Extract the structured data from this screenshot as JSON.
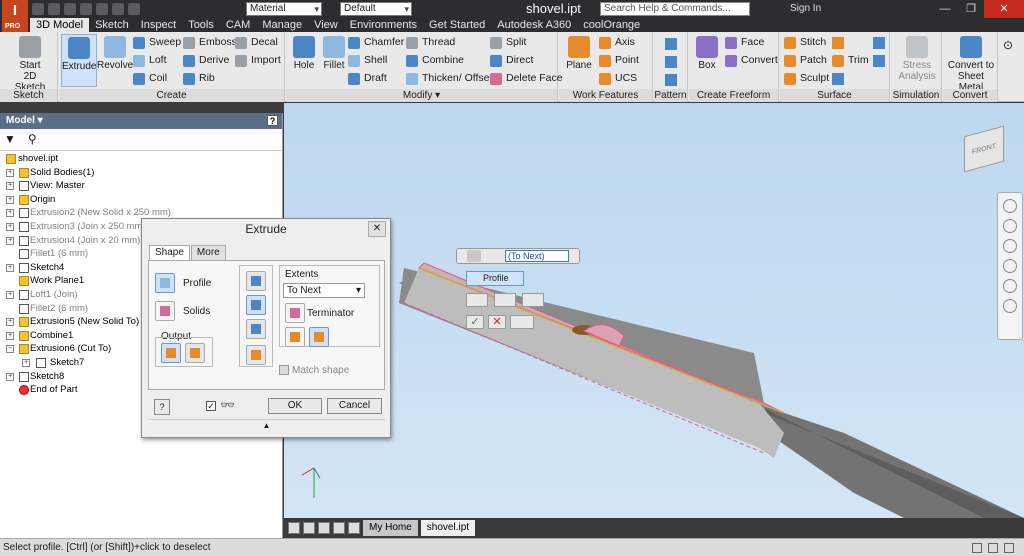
{
  "title": {
    "logo_letter": "I",
    "logo_sub": "PRO",
    "material": "Material",
    "appearance": "Default",
    "doc_name": "shovel.ipt",
    "search_placeholder": "Search Help & Commands...",
    "sign_in": "Sign In"
  },
  "tabs": [
    "3D Model",
    "Sketch",
    "Inspect",
    "Tools",
    "CAM",
    "Manage",
    "View",
    "Environments",
    "Get Started",
    "Autodesk A360",
    "coolOrange"
  ],
  "ribbon": {
    "sketch": {
      "start_line1": "Start",
      "start_line2": "2D Sketch",
      "title": "Sketch"
    },
    "create": {
      "extrude": "Extrude",
      "revolve": "Revolve",
      "sweep": "Sweep",
      "emboss": "Emboss",
      "decal": "Decal",
      "loft": "Loft",
      "derive": "Derive",
      "import": "Import",
      "coil": "Coil",
      "rib": "Rib",
      "title": "Create"
    },
    "modify": {
      "hole": "Hole",
      "fillet": "Fillet",
      "chamfer": "Chamfer",
      "thread": "Thread",
      "split": "Split",
      "shell": "Shell",
      "combine": "Combine",
      "direct": "Direct",
      "draft": "Draft",
      "thicken": "Thicken/ Offset",
      "delete_face": "Delete Face",
      "title": "Modify ▾"
    },
    "work": {
      "plane": "Plane",
      "axis": "Axis",
      "point": "Point",
      "ucs": "UCS",
      "title": "Work Features"
    },
    "pattern": {
      "title": "Pattern"
    },
    "freeform": {
      "box": "Box",
      "face": "Face",
      "convert": "Convert",
      "title": "Create Freeform"
    },
    "surface": {
      "stitch": "Stitch",
      "patch": "Patch",
      "trim": "Trim",
      "sculpt": "Sculpt",
      "title": "Surface"
    },
    "simulation": {
      "stress_line1": "Stress",
      "stress_line2": "Analysis",
      "title": "Simulation"
    },
    "convert": {
      "line1": "Convert to",
      "line2": "Sheet Metal",
      "title": "Convert"
    }
  },
  "browser": {
    "header": "Model ▾",
    "help": "?",
    "nodes": [
      {
        "label": "shovel.ipt",
        "dim": false
      },
      {
        "label": "Solid Bodies(1)",
        "dim": false
      },
      {
        "label": "View: Master",
        "dim": false
      },
      {
        "label": "Origin",
        "dim": false
      },
      {
        "label": "Extrusion2 (New Solid x 250 mm)",
        "dim": true
      },
      {
        "label": "Extrusion3 (Join x 250 mm /",
        "dim": true
      },
      {
        "label": "Extrusion4 (Join x 20 mm)",
        "dim": true
      },
      {
        "label": "Fillet1 (6 mm)",
        "dim": true
      },
      {
        "label": "Sketch4",
        "dim": false
      },
      {
        "label": "Work Plane1",
        "dim": false
      },
      {
        "label": "Loft1 (Join)",
        "dim": true
      },
      {
        "label": "Fillet2 (6 mm)",
        "dim": true
      },
      {
        "label": "Extrusion5 (New Solid To)",
        "dim": false
      },
      {
        "label": "Combine1",
        "dim": false
      },
      {
        "label": "Extrusion6 (Cut To)",
        "dim": false
      },
      {
        "label": "Sketch7",
        "dim": false
      },
      {
        "label": "Sketch8",
        "dim": false
      },
      {
        "label": "End of Part",
        "dim": false
      }
    ]
  },
  "dialog": {
    "title": "Extrude",
    "tab_shape": "Shape",
    "tab_more": "More",
    "profile": "Profile",
    "solids": "Solids",
    "output": "Output",
    "extents": "Extents",
    "extents_value": "To Next",
    "terminator": "Terminator",
    "match_shape": "Match shape",
    "ok": "OK",
    "cancel": "Cancel",
    "help": "?"
  },
  "minitoolbar": {
    "value": "(To Next)",
    "profile": "Profile"
  },
  "doc_tabs": [
    "My Home",
    "shovel.ipt"
  ],
  "viewcube_label": "FRONT",
  "status": "Select profile. [Ctrl] (or [Shift])+click to deselect"
}
